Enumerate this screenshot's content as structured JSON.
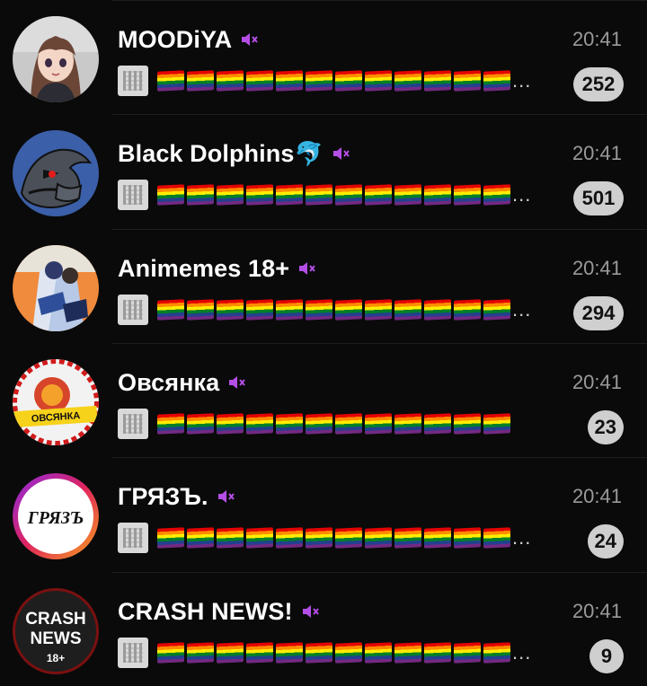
{
  "chats": [
    {
      "title": "MOODiYA",
      "emoji": "",
      "time": "20:41",
      "unread": "252",
      "avatar": "anime-girl-avatar"
    },
    {
      "title": "Black Dolphins",
      "emoji": "🐬",
      "time": "20:41",
      "unread": "501",
      "avatar": "dolphin-avatar"
    },
    {
      "title": "Animemes 18+",
      "emoji": "",
      "time": "20:41",
      "unread": "294",
      "avatar": "anime-group-avatar"
    },
    {
      "title": "Овсянка",
      "emoji": "",
      "time": "20:41",
      "unread": "23",
      "avatar": "oatmeal-avatar",
      "avatar_text": "ОВСЯНКА"
    },
    {
      "title": "ГРЯЗЪ.",
      "emoji": "",
      "time": "20:41",
      "unread": "24",
      "avatar": "gryaz-avatar",
      "avatar_text": "ГРЯЗЪ"
    },
    {
      "title": "CRASH NEWS!",
      "emoji": "",
      "time": "20:41",
      "unread": "9",
      "avatar": "crash-news-avatar",
      "avatar_text": [
        "CRASH",
        "NEWS",
        "18+"
      ]
    }
  ],
  "preview": {
    "flag_count": 12,
    "ellipsis": "...",
    "flag_icon": "rainbow-flag-icon",
    "thumb_icon": "document-thumbnail-icon"
  },
  "colors": {
    "background": "#0a0a0a",
    "mute": "#b44ee6",
    "badge": "#cfcfcf",
    "time": "#9a9a9a"
  }
}
